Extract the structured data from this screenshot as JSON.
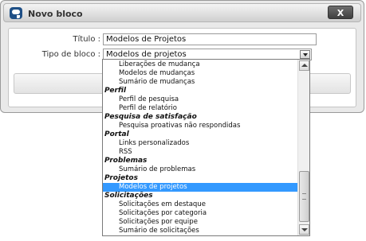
{
  "dialog": {
    "title": "Novo bloco",
    "close_label": "X"
  },
  "form": {
    "titulo_label": "Título :",
    "titulo_value": "Modelos de Projetos",
    "tipo_label": "Tipo de bloco :",
    "tipo_value": "Modelos de projetos"
  },
  "dropdown": {
    "options": [
      {
        "label": "Liberações de mudança",
        "kind": "item"
      },
      {
        "label": "Modelos de mudanças",
        "kind": "item"
      },
      {
        "label": "Sumário de mudanças",
        "kind": "item"
      },
      {
        "label": "Perfil",
        "kind": "group"
      },
      {
        "label": "Perfil de pesquisa",
        "kind": "item"
      },
      {
        "label": "Perfil de relatório",
        "kind": "item"
      },
      {
        "label": "Pesquisa de satisfação",
        "kind": "group"
      },
      {
        "label": "Pesquisa proativas não respondidas",
        "kind": "item"
      },
      {
        "label": "Portal",
        "kind": "group"
      },
      {
        "label": "Links personalizados",
        "kind": "item"
      },
      {
        "label": "RSS",
        "kind": "item"
      },
      {
        "label": "Problemas",
        "kind": "group"
      },
      {
        "label": "Sumário de problemas",
        "kind": "item"
      },
      {
        "label": "Projetos",
        "kind": "group"
      },
      {
        "label": "Modelos de projetos",
        "kind": "item",
        "selected": true
      },
      {
        "label": "Solicitações",
        "kind": "group"
      },
      {
        "label": "Solicitações em destaque",
        "kind": "item"
      },
      {
        "label": "Solicitações por categoria",
        "kind": "item"
      },
      {
        "label": "Solicitações por equipe",
        "kind": "item"
      },
      {
        "label": "Sumário de solicitações",
        "kind": "item"
      }
    ]
  },
  "icons": {
    "app": "chat-bubble-icon",
    "select_arrow": "chevron-down-icon",
    "scroll_up": "arrow-up-icon",
    "scroll_down": "arrow-down-icon"
  },
  "colors": {
    "selection": "#3399ff",
    "app_icon": "#1e4f86"
  }
}
